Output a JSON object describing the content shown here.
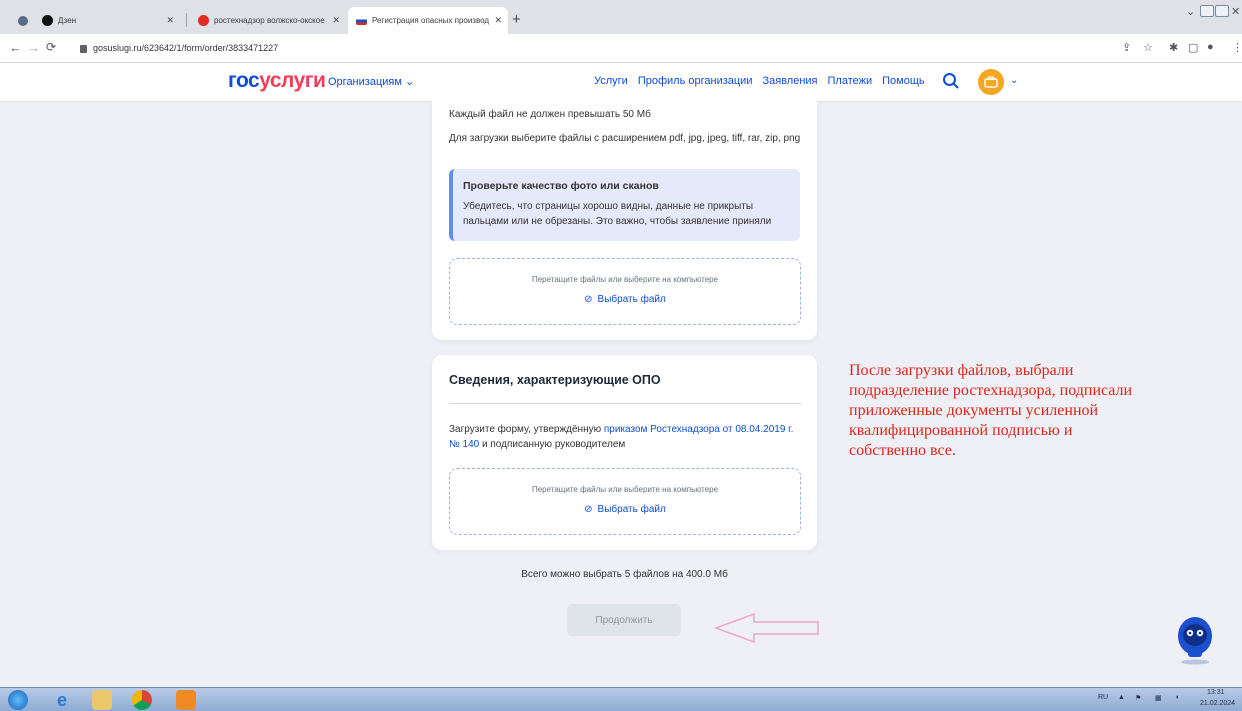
{
  "browser": {
    "tabs": [
      {
        "label": "Дзен",
        "active": false
      },
      {
        "label": "ростехнадзор волжско-окское",
        "active": false
      },
      {
        "label": "Регистрация опасных производ",
        "active": true
      }
    ],
    "new_tab": "+",
    "url": "gosuslugi.ru/623642/1/form/order/3833471227"
  },
  "header": {
    "logo_part1": "гос",
    "logo_part2": "услуги",
    "org_menu": "Организациям ⌄",
    "nav": [
      "Услуги",
      "Профиль организации",
      "Заявления",
      "Платежи",
      "Помощь"
    ]
  },
  "upload_card": {
    "max_size": "Каждый файл не должен превышать 50 Мб",
    "formats": "Для загрузки выберите файлы с расширением pdf, jpg, jpeg, tiff, rar, zip, png",
    "info_title": "Проверьте качество фото или сканов",
    "info_text": "Убедитесь, что страницы хорошо видны, данные не прикрыты пальцами или не обрезаны. Это важно, чтобы заявление приняли",
    "drop_hint": "Перетащите файлы или выберите на компьютере",
    "pick_file": "Выбрать файл"
  },
  "opo_card": {
    "title": "Сведения, характеризующие ОПО",
    "text_before": "Загрузите форму, утверждённую ",
    "link": "приказом Ростехнадзора от 08.04.2019 г. № 140",
    "text_after": " и подписанную руководителем",
    "drop_hint": "Перетащите файлы или выберите на компьютере",
    "pick_file": "Выбрать файл"
  },
  "limit_text": "Всего можно выбрать 5 файлов на 400.0 Мб",
  "continue_button": "Продолжить",
  "annotation": "После загрузки файлов, выбрали подразделение ростехнадзора, подписали приложенные документы усиленной квалифицированной подписью и собственно все.",
  "taskbar": {
    "lang": "RU",
    "time": "13:31",
    "date": "21.02.2024"
  }
}
